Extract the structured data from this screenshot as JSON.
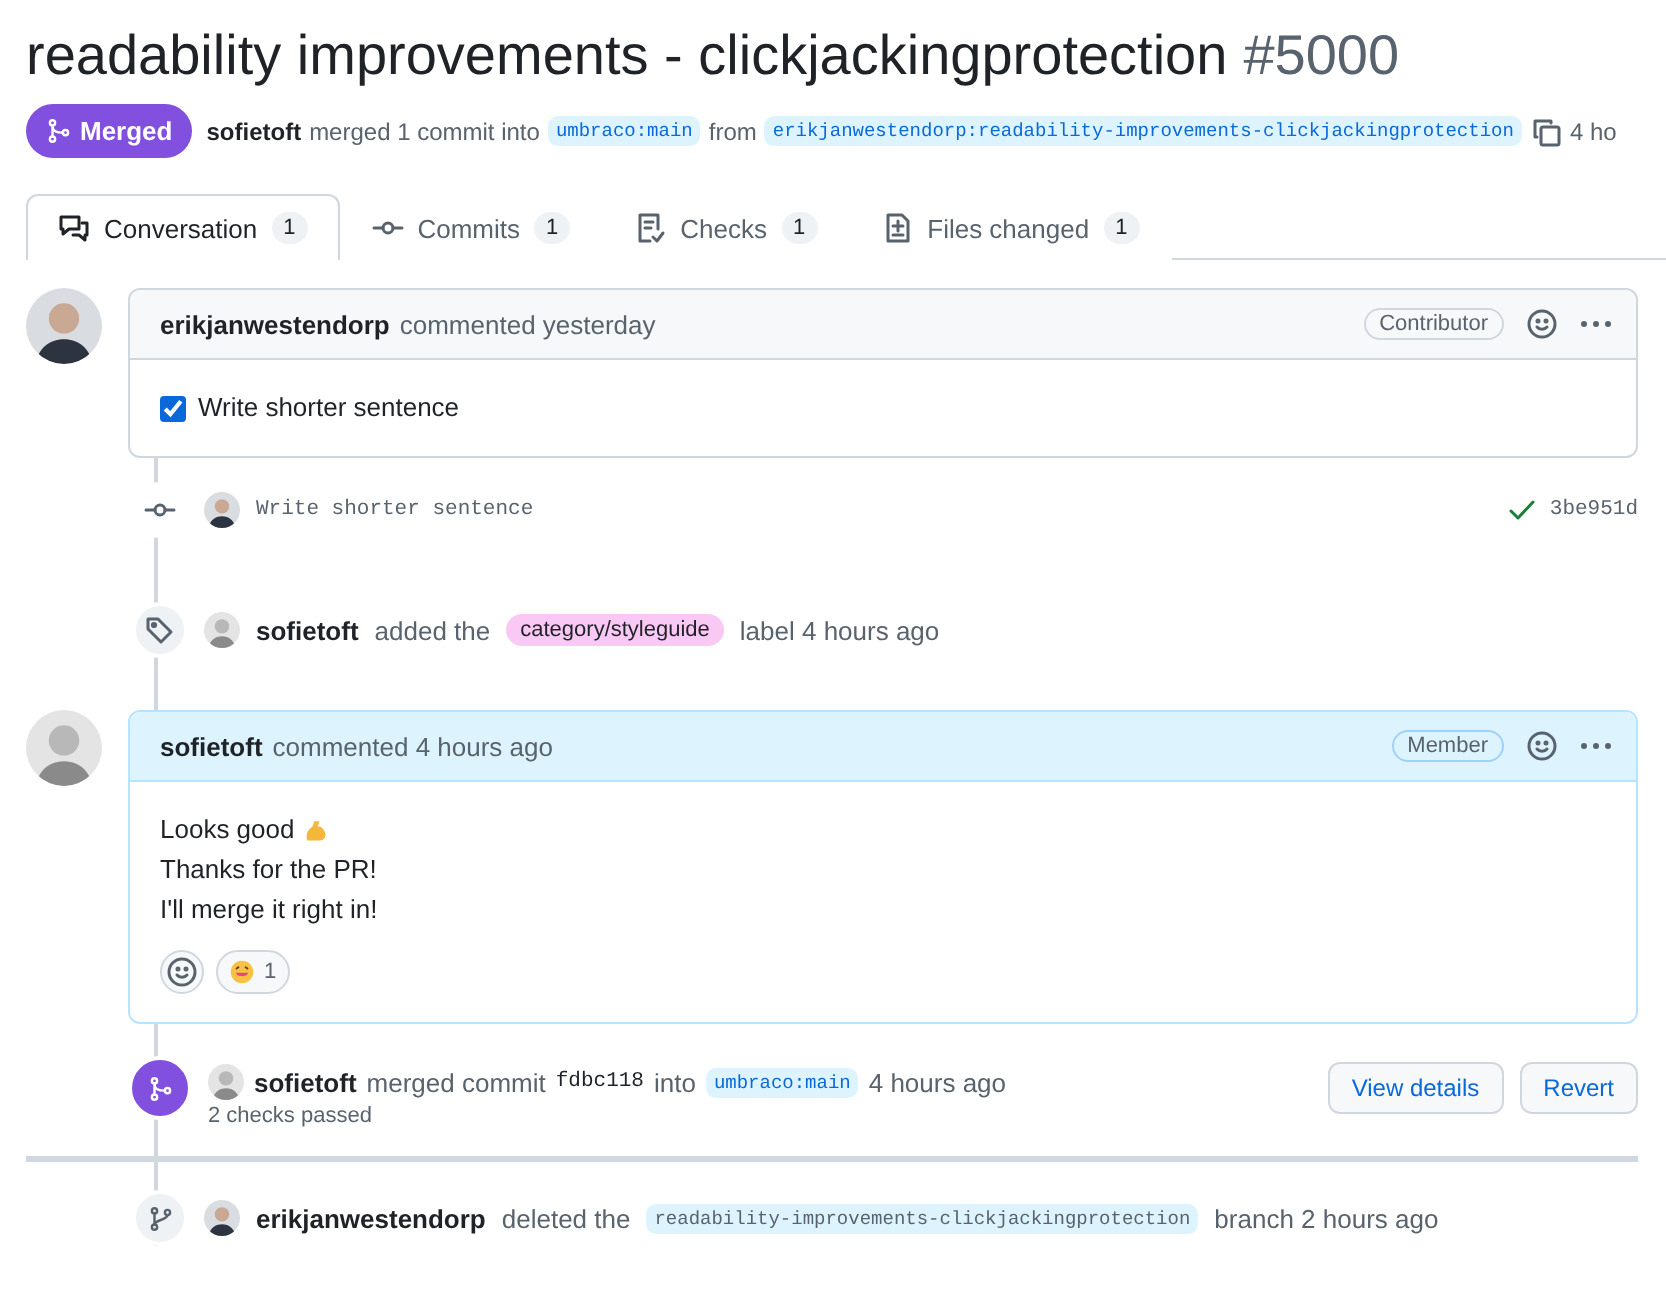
{
  "title": "readability improvements - clickjackingprotection",
  "number": "#5000",
  "state": {
    "label": "Merged",
    "kind": "merged"
  },
  "meta": {
    "author": "sofietoft",
    "action": "merged 1 commit into",
    "base": "umbraco:main",
    "from": "from",
    "head": "erikjanwestendorp:readability-improvements-clickjackingprotection",
    "time": "4 ho"
  },
  "tabs": [
    {
      "label": "Conversation",
      "count": "1",
      "selected": true
    },
    {
      "label": "Commits",
      "count": "1",
      "selected": false
    },
    {
      "label": "Checks",
      "count": "1",
      "selected": false
    },
    {
      "label": "Files changed",
      "count": "1",
      "selected": false
    }
  ],
  "timeline": [
    {
      "kind": "comment",
      "author": "erikjanwestendorp",
      "action": "commented yesterday",
      "role": "Contributor",
      "highlighted": false,
      "tasks": [
        {
          "text": "Write shorter sentence",
          "checked": true
        }
      ]
    },
    {
      "kind": "commit",
      "message": "Write shorter sentence",
      "sha": "3be951d",
      "passed": true
    },
    {
      "kind": "labeled",
      "actor": "sofietoft",
      "action": "added the",
      "label": {
        "name": "category/styleguide",
        "color": "#f9c8f4"
      },
      "after": "label 4 hours ago"
    },
    {
      "kind": "comment",
      "author": "sofietoft",
      "action": "commented 4 hours ago",
      "role": "Member",
      "highlighted": true,
      "lines": [
        "Looks good",
        "Thanks for the PR!",
        "I'll merge it right in!"
      ],
      "reactions": [
        {
          "count": "1"
        }
      ]
    },
    {
      "kind": "merged",
      "actor": "sofietoft",
      "action": "merged commit",
      "sha": "fdbc118",
      "into": "into",
      "base": "umbraco:main",
      "time": "4 hours ago",
      "checks": "2 checks passed",
      "buttons": [
        "View details",
        "Revert"
      ]
    },
    {
      "kind": "divider"
    },
    {
      "kind": "deleted",
      "actor": "erikjanwestendorp",
      "action": "deleted the",
      "branch": "readability-improvements-clickjackingprotection",
      "after": "branch 2 hours ago"
    }
  ]
}
